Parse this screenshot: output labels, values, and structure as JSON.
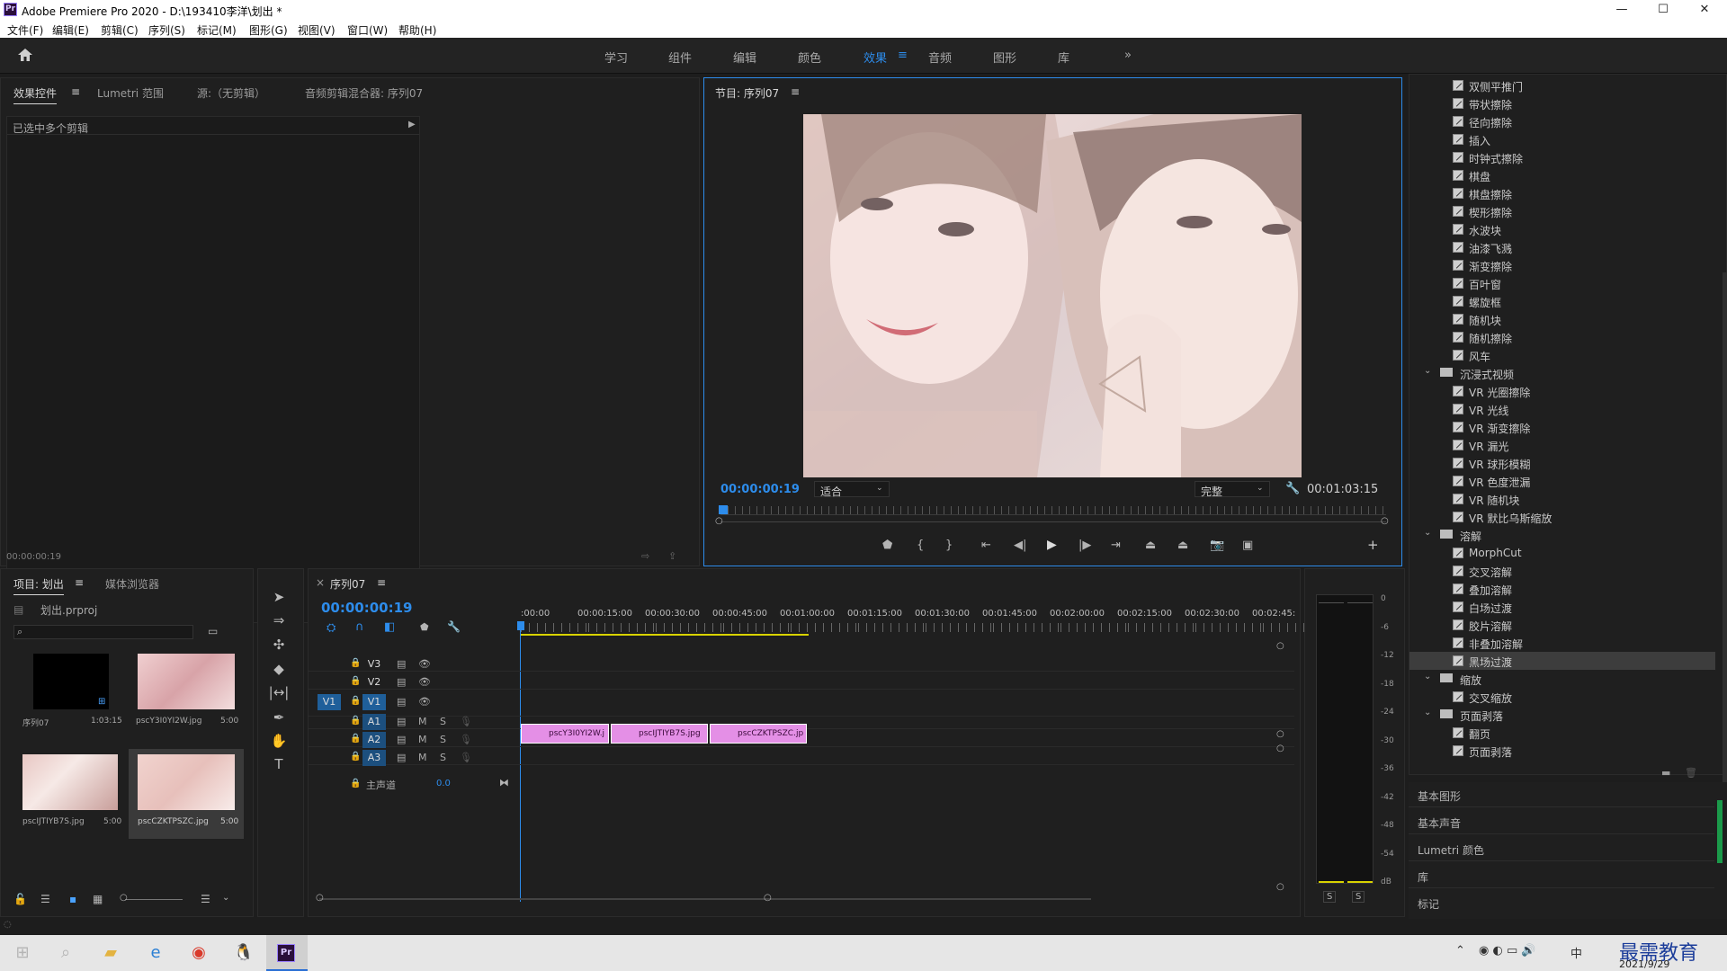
{
  "app": {
    "title": "Adobe Premiere Pro 2020 - D:\\193410李洋\\划出 *",
    "icon_text": "Pr"
  },
  "window": {
    "minimize": "—",
    "maximize": "☐",
    "close": "✕"
  },
  "menu": [
    "文件(F)",
    "编辑(E)",
    "剪辑(C)",
    "序列(S)",
    "标记(M)",
    "图形(G)",
    "视图(V)",
    "窗口(W)",
    "帮助(H)"
  ],
  "workspaces": [
    "学习",
    "组件",
    "编辑",
    "颜色",
    "效果",
    "音频",
    "图形",
    "库"
  ],
  "workspace_active": "效果",
  "workspace_more": "»",
  "source_panel": {
    "tabs": [
      "效果控件",
      "Lumetri 范围",
      "源:（无剪辑）",
      "音频剪辑混合器: 序列07"
    ],
    "message": "已选中多个剪辑",
    "timecode": "00:00:00:19"
  },
  "program": {
    "title": "节目: 序列07",
    "timecode": "00:00:00:19",
    "fit": "适合",
    "quality": "完整",
    "duration": "00:01:03:15"
  },
  "project": {
    "tabs": [
      "项目: 划出",
      "媒体浏览器"
    ],
    "filename": "划出.prproj",
    "items": [
      {
        "name": "序列07",
        "dur": "1:03:15"
      },
      {
        "name": "pscY3I0YI2W.jpg",
        "dur": "5:00"
      },
      {
        "name": "pscIJTIYB7S.jpg",
        "dur": "5:00"
      },
      {
        "name": "pscCZKTPSZC.jpg",
        "dur": "5:00"
      }
    ]
  },
  "timeline": {
    "tab": "序列07",
    "timecode": "00:00:00:19",
    "ruler": [
      ":00:00",
      "00:00:15:00",
      "00:00:30:00",
      "00:00:45:00",
      "00:01:00:00",
      "00:01:15:00",
      "00:01:30:00",
      "00:01:45:00",
      "00:02:00:00",
      "00:02:15:00",
      "00:02:30:00",
      "00:02:45:"
    ],
    "tracks": [
      {
        "name": "V3"
      },
      {
        "name": "V2"
      },
      {
        "name": "V1",
        "src": "V1"
      },
      {
        "name": "A1",
        "m": "M",
        "s": "S"
      },
      {
        "name": "A2",
        "m": "M",
        "s": "S"
      },
      {
        "name": "A3",
        "m": "M",
        "s": "S"
      }
    ],
    "master": {
      "label": "主声道",
      "value": "0.0"
    },
    "clips": [
      "pscY3I0YI2W.j",
      "pscIJTIYB7S.jpg",
      "pscCZKTPSZC.jp"
    ]
  },
  "meter": {
    "labels": [
      "0",
      "-6",
      "-12",
      "-18",
      "-24",
      "-30",
      "-36",
      "-42",
      "-48",
      "-54",
      "dB"
    ],
    "solo": [
      "S",
      "S"
    ]
  },
  "effects": {
    "items": [
      {
        "type": "item",
        "label": "双侧平推门"
      },
      {
        "type": "item",
        "label": "带状擦除"
      },
      {
        "type": "item",
        "label": "径向擦除"
      },
      {
        "type": "item",
        "label": "插入"
      },
      {
        "type": "item",
        "label": "时钟式擦除"
      },
      {
        "type": "item",
        "label": "棋盘"
      },
      {
        "type": "item",
        "label": "棋盘擦除"
      },
      {
        "type": "item",
        "label": "楔形擦除"
      },
      {
        "type": "item",
        "label": "水波块"
      },
      {
        "type": "item",
        "label": "油漆飞溅"
      },
      {
        "type": "item",
        "label": "渐变擦除"
      },
      {
        "type": "item",
        "label": "百叶窗"
      },
      {
        "type": "item",
        "label": "螺旋框"
      },
      {
        "type": "item",
        "label": "随机块"
      },
      {
        "type": "item",
        "label": "随机擦除"
      },
      {
        "type": "item",
        "label": "风车"
      },
      {
        "type": "folder",
        "label": "沉浸式视频"
      },
      {
        "type": "item",
        "label": "VR 光圈擦除"
      },
      {
        "type": "item",
        "label": "VR 光线"
      },
      {
        "type": "item",
        "label": "VR 渐变擦除"
      },
      {
        "type": "item",
        "label": "VR 漏光"
      },
      {
        "type": "item",
        "label": "VR 球形模糊"
      },
      {
        "type": "item",
        "label": "VR 色度泄漏"
      },
      {
        "type": "item",
        "label": "VR 随机块"
      },
      {
        "type": "item",
        "label": "VR 默比乌斯缩放"
      },
      {
        "type": "folder",
        "label": "溶解"
      },
      {
        "type": "item",
        "label": "MorphCut"
      },
      {
        "type": "item",
        "label": "交叉溶解"
      },
      {
        "type": "item",
        "label": "叠加溶解"
      },
      {
        "type": "item",
        "label": "白场过渡"
      },
      {
        "type": "item",
        "label": "胶片溶解"
      },
      {
        "type": "item",
        "label": "非叠加溶解"
      },
      {
        "type": "item",
        "label": "黑场过渡"
      },
      {
        "type": "folder",
        "label": "缩放"
      },
      {
        "type": "item",
        "label": "交叉缩放"
      },
      {
        "type": "folder",
        "label": "页面剥落"
      },
      {
        "type": "item",
        "label": "翻页"
      },
      {
        "type": "item",
        "label": "页面剥落"
      }
    ],
    "selected": "黑场过渡",
    "sections": [
      "基本图形",
      "基本声音",
      "Lumetri 颜色",
      "库",
      "标记"
    ]
  },
  "taskbar": {
    "time": "2021/9/29",
    "ime": "中",
    "watermark": "最需教育"
  }
}
